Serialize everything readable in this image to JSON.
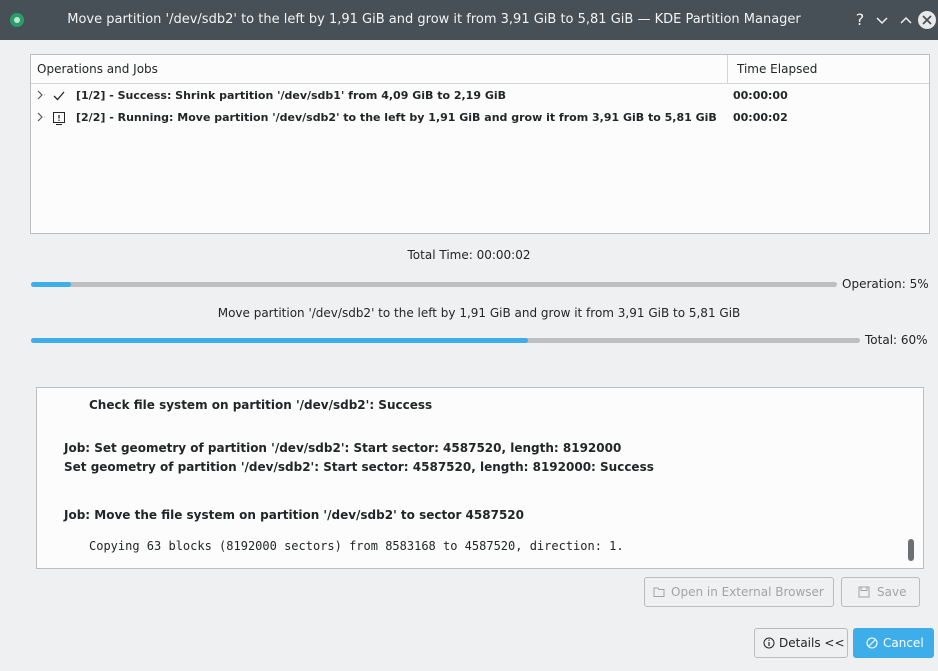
{
  "window": {
    "title": "Move partition '/dev/sdb2' to the left by 1,91 GiB and grow it from 3,91 GiB to 5,81 GiB — KDE Partition Manager",
    "help_glyph": "?"
  },
  "jobs_table": {
    "columns": [
      "Operations and Jobs",
      "Time Elapsed"
    ],
    "rows": [
      {
        "text": "[1/2] - Success: Shrink partition '/dev/sdb1' from 4,09 GiB to 2,19 GiB",
        "time": "00:00:00",
        "status_icon": "checkmark-icon"
      },
      {
        "text": "[2/2] - Running: Move partition '/dev/sdb2' to the left by 1,91 GiB and grow it from 3,91 GiB to 5,81 GiB",
        "time": "00:00:02",
        "status_icon": "running-job-icon"
      }
    ]
  },
  "progress": {
    "total_time": "Total Time: 00:00:02",
    "operation_label": "Operation: 5%",
    "operation_fraction": 0.05,
    "operation_description": "Move partition '/dev/sdb2' to the left by 1,91 GiB and grow it from 3,91 GiB to 5,81 GiB",
    "total_label": "Total: 60%",
    "total_fraction": 0.6,
    "bar_color": "#3daee9"
  },
  "details_log": {
    "lines": [
      "Check file system on partition '/dev/sdb2': Success",
      "Job: Set geometry of partition '/dev/sdb2': Start sector: 4587520, length: 8192000",
      "Set geometry of partition '/dev/sdb2': Start sector: 4587520, length: 8192000: Success",
      "Job: Move the file system on partition '/dev/sdb2' to sector 4587520",
      "Copying 63 blocks (8192000 sectors) from 8583168 to 4587520, direction: 1."
    ]
  },
  "buttons": {
    "open_browser": "Open in External Browser",
    "save": "Save",
    "details": "Details <<",
    "cancel": "Cancel"
  },
  "colors": {
    "titlebar": "#475057",
    "accent": "#3daee9",
    "window_bg": "#eff0f1"
  }
}
